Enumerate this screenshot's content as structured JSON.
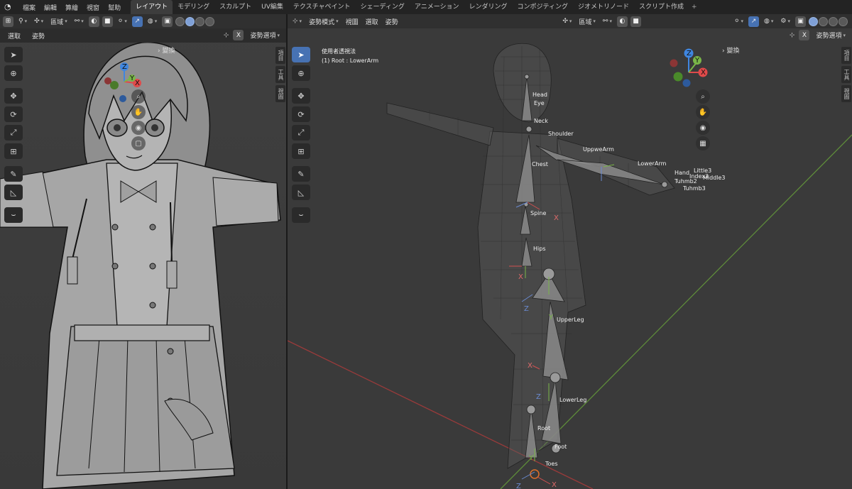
{
  "topbar": {
    "menus": [
      "檔案",
      "編輯",
      "算繪",
      "視窗",
      "幫助"
    ],
    "workspaces": [
      "レイアウト",
      "モデリング",
      "スカルプト",
      "UV編集",
      "テクスチャペイント",
      "シェーディング",
      "アニメーション",
      "レンダリング",
      "コンポジティング",
      "ジオメトリノード",
      "スクリプト作成"
    ],
    "active_workspace": "レイアウト",
    "add_label": "+"
  },
  "left_view": {
    "region_label": "區域",
    "sub_menu": [
      "選取",
      "姿勢"
    ],
    "pose_options": "姿勢選項",
    "x_label": "X",
    "transform_label": "變換",
    "sidetabs": [
      "項目",
      "工具",
      "視圖"
    ]
  },
  "right_view": {
    "mode_label": "姿勢模式",
    "menus": [
      "視圖",
      "選取",
      "姿勢"
    ],
    "region_label": "區域",
    "pose_options": "姿勢選項",
    "x_label": "X",
    "transform_label": "變換",
    "overlay_line1": "使用者透視法",
    "overlay_line2": "(1) Root : LowerArm",
    "sidetabs": [
      "項目",
      "工具",
      "視圖"
    ],
    "bones": [
      "Head",
      "Eye",
      "Neck",
      "Shoulder",
      "UppweArm",
      "LowerArm",
      "Hand",
      "Chest",
      "Spine",
      "Hips",
      "UpperLeg",
      "LowerLeg",
      "Root",
      "Foot",
      "Toes"
    ],
    "finger_labels": [
      "Little3",
      "Index3",
      "Middle3",
      "Tuhmb2",
      "Tuhmb3"
    ]
  },
  "gizmo": {
    "x": "X",
    "y": "Y",
    "z": "Z"
  },
  "colors": {
    "accent": "#4772b3",
    "x_axis": "#e04a4a",
    "y_axis": "#7ab648",
    "z_axis": "#3f86e0"
  }
}
